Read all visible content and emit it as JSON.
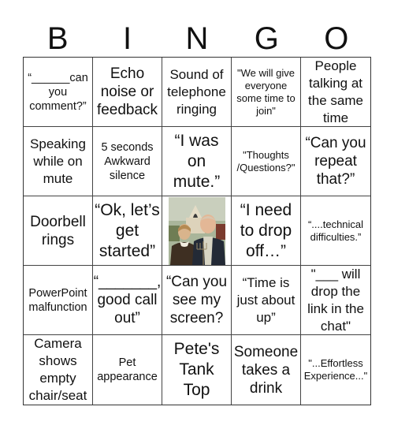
{
  "header": {
    "letters": [
      "B",
      "I",
      "N",
      "G",
      "O"
    ]
  },
  "cells": [
    {
      "text": "“______can you comment?”",
      "size": "s-sm"
    },
    {
      "text": "Echo noise or feedback",
      "size": "s-lg"
    },
    {
      "text": "Sound of telephone ringing",
      "size": "s-md"
    },
    {
      "text": "\"We will give everyone some time to join\"",
      "size": "s-xs"
    },
    {
      "text": "People talking at the same time",
      "size": "s-md"
    },
    {
      "text": "Speaking while on mute",
      "size": "s-md"
    },
    {
      "text": "5 seconds Awkward silence",
      "size": "s-sm"
    },
    {
      "text": "“I was on mute.”",
      "size": "s-xl"
    },
    {
      "text": "\"Thoughts /Questions?\"",
      "size": "s-xs"
    },
    {
      "text": "“Can you repeat that?”",
      "size": "s-lg"
    },
    {
      "text": "Doorbell rings",
      "size": "s-lg"
    },
    {
      "text": "“Ok, let’s get started”",
      "size": "s-xl"
    },
    {
      "text": "",
      "size": "free",
      "image": "american-gothic-painting"
    },
    {
      "text": "“I need to drop off…”",
      "size": "s-xl"
    },
    {
      "text": "“....technical difficulties.”",
      "size": "s-xs"
    },
    {
      "text": "PowerPoint malfunction",
      "size": "s-sm"
    },
    {
      "text": "“_______, good call out”",
      "size": "s-lg"
    },
    {
      "text": "“Can you see my screen?",
      "size": "s-lg"
    },
    {
      "text": "“Time is just about up”",
      "size": "s-md"
    },
    {
      "text": "\"___ will drop the link in the chat\"",
      "size": "s-md"
    },
    {
      "text": "Camera shows empty chair/seat",
      "size": "s-md"
    },
    {
      "text": "Pet appearance",
      "size": "s-sm"
    },
    {
      "text": "Pete's Tank Top",
      "size": "s-xl"
    },
    {
      "text": "Someone takes a drink",
      "size": "s-lg"
    },
    {
      "text": "\"...Effortless Experience...\"",
      "size": "s-xs"
    }
  ]
}
